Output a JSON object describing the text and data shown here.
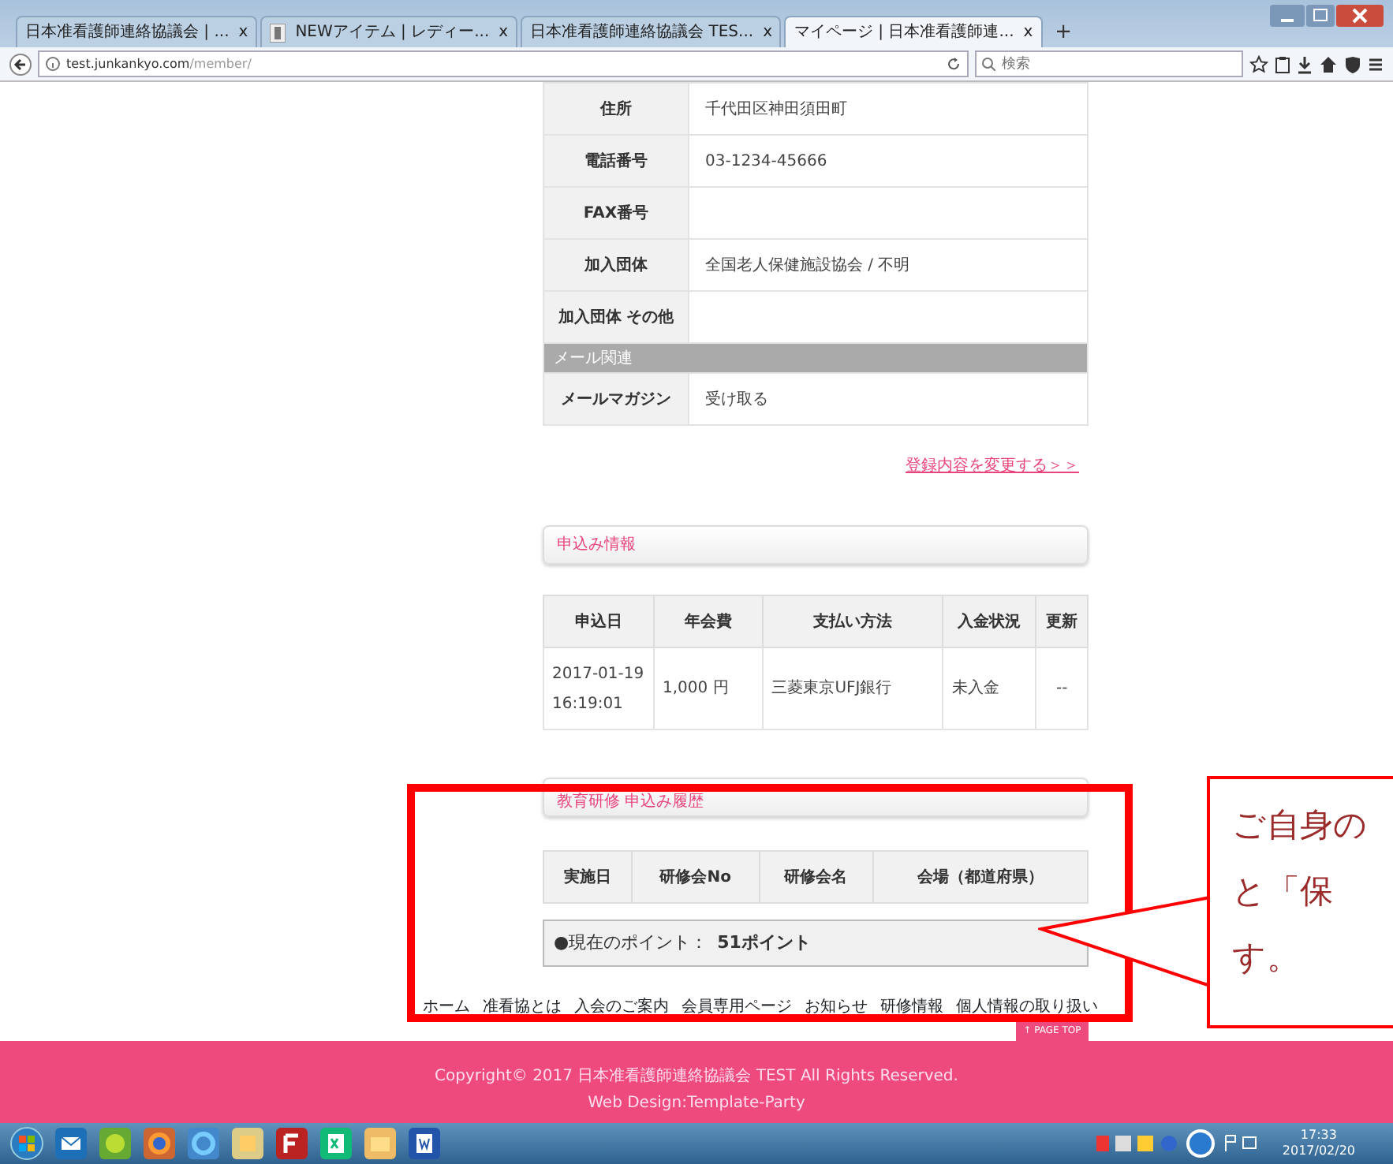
{
  "browser": {
    "tabs": [
      {
        "title": "日本准看護師連絡協議会 | ...",
        "close": "x",
        "selected": false
      },
      {
        "title": "NEWアイテム | レディー...",
        "close": "x",
        "selected": false
      },
      {
        "title": "日本准看護師連絡協議会 TES...",
        "close": "x",
        "selected": false
      },
      {
        "title": "マイページ | 日本准看護師連...",
        "close": "x",
        "selected": true
      }
    ],
    "new_tab": "+",
    "url_host": "test.junkankyo.com",
    "url_path": "/member/",
    "search_placeholder": "検索"
  },
  "profile_table": [
    {
      "kind": "row",
      "label": "住所",
      "value": "千代田区神田須田町"
    },
    {
      "kind": "row",
      "label": "電話番号",
      "value": "03-1234-45666"
    },
    {
      "kind": "row",
      "label": "FAX番号"
    },
    {
      "kind": "row",
      "label": "加入団体",
      "value": "全国老人保健施設協会 / 不明"
    },
    {
      "kind": "row",
      "label": "加入団体 その他"
    },
    {
      "kind": "section",
      "label": "メール関連"
    },
    {
      "kind": "row",
      "label": "メールマガジン",
      "value": "受け取る"
    }
  ],
  "edit_link": "登録内容を変更する＞＞",
  "application_panel": "申込み情報",
  "application_table": {
    "columns": [
      "申込日",
      "年会費",
      "支払い方法",
      "入金状況",
      "更新"
    ],
    "rows": [
      [
        "2017-01-19 16:19:01",
        "1,000 円",
        "三菱東京UFJ銀行",
        "未入金",
        "--"
      ]
    ]
  },
  "training_panel": "教育研修 申込み履歴",
  "training_table": {
    "columns": [
      "実施日",
      "研修会No",
      "研修会名",
      "会場（都道府県）"
    ]
  },
  "points": {
    "label": "●現在のポイント：",
    "value": "51ポイント"
  },
  "footer_links": [
    "ホーム",
    "准看協とは",
    "入会のご案内",
    "会員専用ページ",
    "お知らせ",
    "研修情報",
    "個人情報の取り扱い"
  ],
  "page_top": "↑ PAGE TOP",
  "copyright": "Copyright© 2017 日本准看護師連絡協議会 TEST All Rights Reserved.",
  "web_design": "Web Design:Template-Party",
  "annotation": {
    "lines": [
      "ご自身の",
      "と「保",
      "す。"
    ]
  },
  "taskbar": {
    "time": "17:33",
    "date": "2017/02/20"
  }
}
